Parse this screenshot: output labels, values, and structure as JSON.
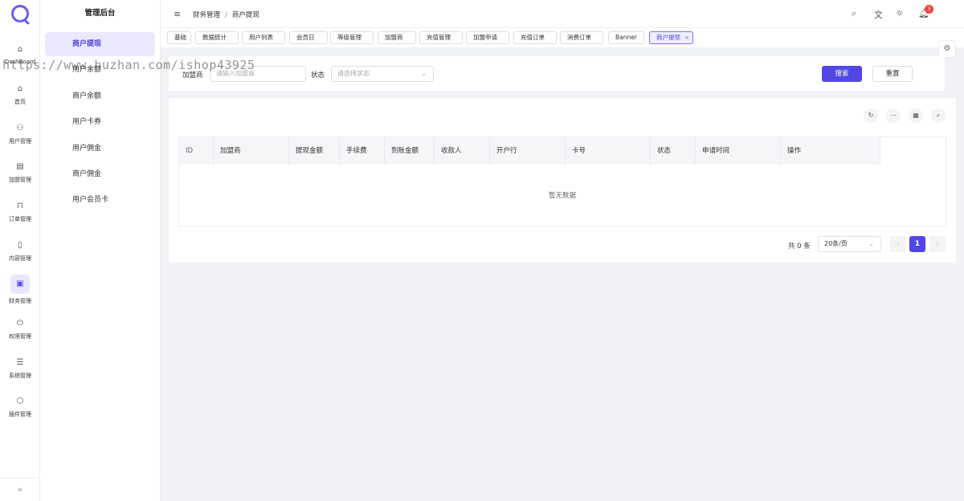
{
  "rail": {
    "items": [
      {
        "label": "DashBoard",
        "icon": "home-icon"
      },
      {
        "label": "首页",
        "icon": "home-icon"
      },
      {
        "label": "用户管理",
        "icon": "users-icon"
      },
      {
        "label": "加盟管理",
        "icon": "building-icon"
      },
      {
        "label": "订单管理",
        "icon": "bag-icon"
      },
      {
        "label": "内容管理",
        "icon": "document-icon"
      },
      {
        "label": "财务管理",
        "icon": "wallet-icon",
        "active": true
      },
      {
        "label": "权限管理",
        "icon": "power-icon"
      },
      {
        "label": "系统管理",
        "icon": "database-icon"
      },
      {
        "label": "插件管理",
        "icon": "cube-icon"
      }
    ],
    "collapse_glyph": "«"
  },
  "menu": {
    "title": "管理后台",
    "items": [
      "商户提现",
      "用户余额",
      "商户余额",
      "用户卡券",
      "用户佣金",
      "商户佣金",
      "用户会员卡"
    ],
    "active_index": 0
  },
  "topbar": {
    "breadcrumb": [
      "财务管理",
      "商户提现"
    ],
    "separator": "/",
    "notification_count": "3"
  },
  "tabs": [
    "基础",
    "数据统计",
    "用户列表",
    "会员日",
    "等级管理",
    "加盟商",
    "充值管理",
    "加盟申请",
    "充值订单",
    "消费订单",
    "Banner",
    "商户提现"
  ],
  "active_tab_close": "×",
  "filter": {
    "franchise_label": "加盟商",
    "franchise_placeholder": "请输入加盟商",
    "status_label": "状态",
    "status_placeholder": "请选择状态",
    "search_button": "搜索",
    "reset_button": "重置"
  },
  "table": {
    "columns": [
      "ID",
      "加盟商",
      "提现金额",
      "手续费",
      "到账金额",
      "收款人",
      "开户行",
      "卡号",
      "状态",
      "申请时间",
      "操作"
    ],
    "empty_text": "暂无数据"
  },
  "pagination": {
    "total_text": "共 0 条",
    "page_size": "20条/页",
    "current_page": "1"
  },
  "watermark": "https://www.huzhan.com/ishop43925",
  "colors": {
    "accent": "#5147e5",
    "active_bg": "#ebe9fd",
    "badge": "#f0443b"
  }
}
